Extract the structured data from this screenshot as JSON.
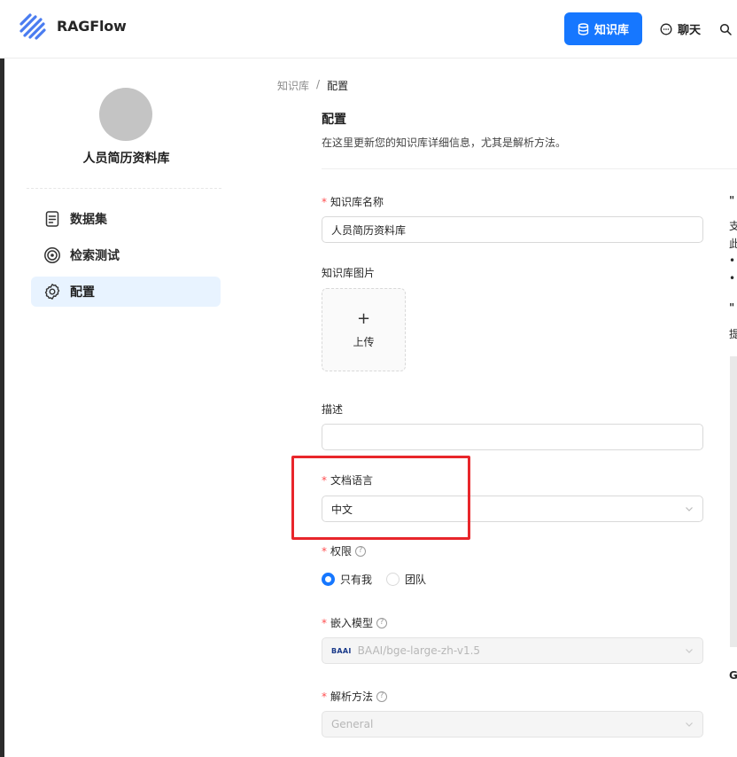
{
  "header": {
    "brand": "RAGFlow",
    "nav": {
      "knowledge_base": "知识库",
      "chat": "聊天"
    }
  },
  "sidebar": {
    "kb_name": "人员简历资料库",
    "items": [
      {
        "label": "数据集",
        "icon": "document-icon"
      },
      {
        "label": "检索测试",
        "icon": "target-icon"
      },
      {
        "label": "配置",
        "icon": "gear-icon",
        "active": true
      }
    ]
  },
  "breadcrumb": {
    "parent": "知识库",
    "separator": "/",
    "current": "配置"
  },
  "page": {
    "title": "配置",
    "subtitle": "在这里更新您的知识库详细信息，尤其是解析方法。"
  },
  "form": {
    "required_mark": "*",
    "help_mark": "?",
    "kb_name_label": "知识库名称",
    "kb_name_value": "人员简历资料库",
    "kb_image_label": "知识库图片",
    "upload_plus": "+",
    "upload_label": "上传",
    "description_label": "描述",
    "description_value": "",
    "language_label": "文档语言",
    "language_value": "中文",
    "permission_label": "权限",
    "permission_options": [
      "只有我",
      "团队"
    ],
    "permission_selected": "只有我",
    "embedding_label": "嵌入模型",
    "embedding_value": "BAAI/bge-large-zh-v1.5",
    "embedding_badge": "BAAI",
    "parser_label": "解析方法",
    "parser_value": "General"
  },
  "right_panel": {
    "frag1": "\"",
    "frag2": "支",
    "frag3": "此",
    "frag4": "•",
    "frag5": "•",
    "frag6": "\"",
    "frag7": "提",
    "frag8": "G"
  },
  "colors": {
    "primary": "#1677ff",
    "highlight": "#e8262b",
    "required": "#ff4d4f"
  }
}
